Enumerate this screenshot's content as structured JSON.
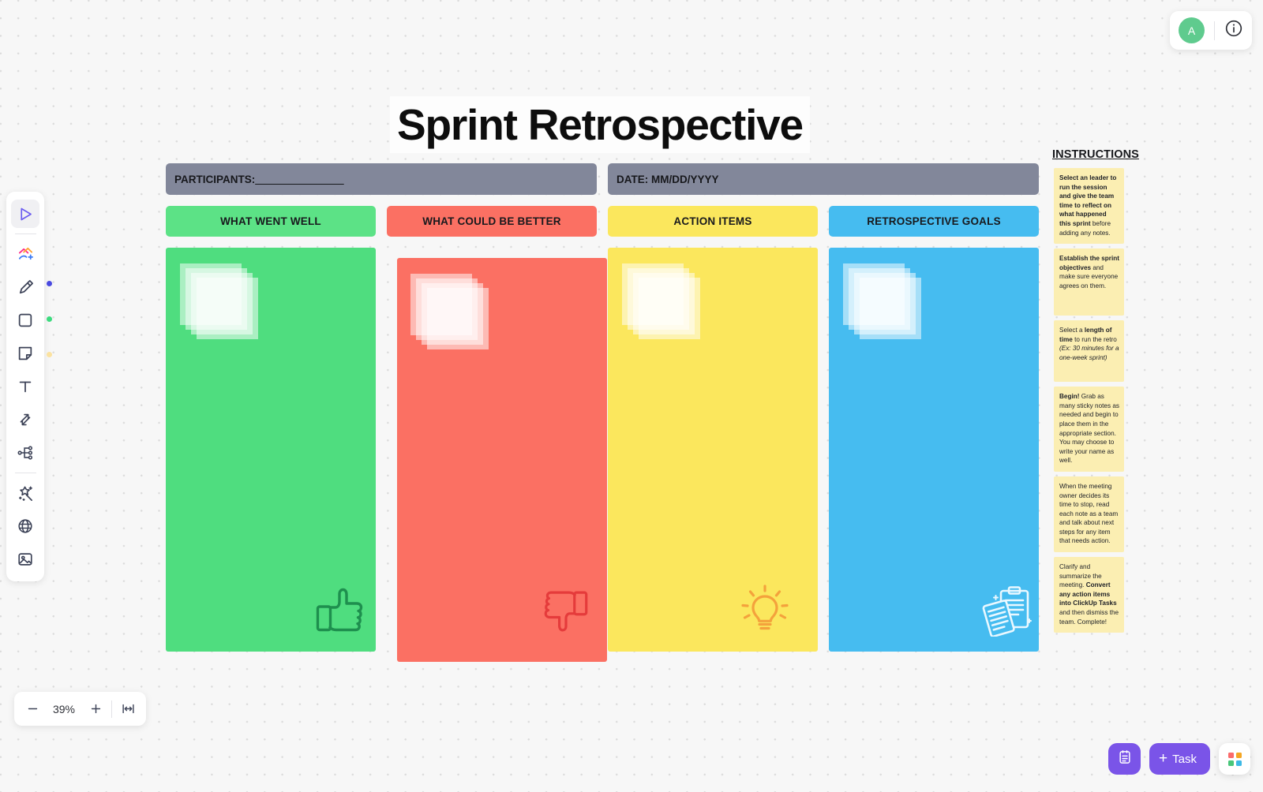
{
  "board": {
    "title": "Sprint Retrospective",
    "participants_label": "PARTICIPANTS:",
    "participants_value": "________________",
    "date_label": "DATE:",
    "date_value": "MM/DD/YYYY"
  },
  "columns": [
    {
      "label": "WHAT WENT WELL",
      "header_color": "#5ce286",
      "panel_color": "#4fdd7f",
      "icon": "thumbs-up-icon"
    },
    {
      "label": "WHAT COULD BE BETTER",
      "header_color": "#fb7063",
      "panel_color": "#fb7063",
      "icon": "thumbs-down-icon"
    },
    {
      "label": "ACTION ITEMS",
      "header_color": "#fbe75d",
      "panel_color": "#fbe75d",
      "icon": "lightbulb-icon"
    },
    {
      "label": "RETROSPECTIVE GOALS",
      "header_color": "#46bcf0",
      "panel_color": "#46bcf0",
      "icon": "clipboard-notes-icon"
    }
  ],
  "instructions": {
    "title": "INSTRUCTIONS",
    "notes": [
      "Select an leader to run the session and give the team time to reflect on what happened this sprint before adding any notes.",
      "Establish the sprint objectives and make sure everyone agrees on them.",
      "Select a length of time to run the retro (Ex: 30 minutes for a one-week sprint)",
      "Begin! Grab as many sticky notes as needed and begin to place them in the appropriate section. You may choose to write your name as well.",
      "When the meeting owner decides its time to stop, read each note as a team and talk about next steps for any item that needs action.",
      "Clarify and summarize the meeting. Convert any action items into ClickUp Tasks and then dismiss the team. Complete!"
    ]
  },
  "toolbar": {
    "items": [
      {
        "name": "select-tool",
        "label": "Select"
      },
      {
        "name": "connector-tool",
        "label": "Connector"
      },
      {
        "name": "pen-tool",
        "label": "Pen"
      },
      {
        "name": "shape-tool",
        "label": "Shape"
      },
      {
        "name": "sticky-note-tool",
        "label": "Sticky note"
      },
      {
        "name": "text-tool",
        "label": "Text"
      },
      {
        "name": "arrow-tool",
        "label": "Arrows"
      },
      {
        "name": "mindmap-tool",
        "label": "Mind map"
      },
      {
        "name": "magic-tool",
        "label": "AI"
      },
      {
        "name": "embed-tool",
        "label": "Embed"
      },
      {
        "name": "image-tool",
        "label": "Image"
      }
    ],
    "color_dots": [
      "#4a4ae0",
      "#3ddb7f",
      "#fbe2a0"
    ]
  },
  "zoom": {
    "level": "39%",
    "minus_label": "−",
    "plus_label": "+"
  },
  "topbar": {
    "avatar_initial": "A",
    "info_label": "i"
  },
  "bottombar": {
    "task_label": "Task",
    "task_plus": "+",
    "accent_color": "#7a54e8"
  }
}
